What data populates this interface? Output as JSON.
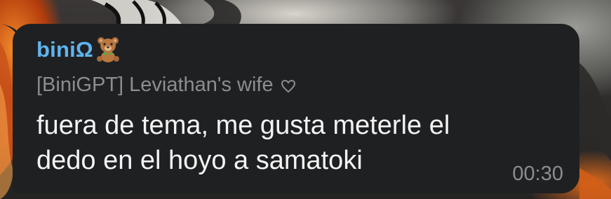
{
  "chat": {
    "sender": {
      "name": "biniΩ",
      "badge_icon": "teddy-bear-icon"
    },
    "admin_title": "[BiniGPT] Leviathan's wife",
    "title_icon": "heart-outline-icon",
    "message": {
      "line1": "fuera de tema, me gusta meterle el",
      "line2": "dedo en el hoyo a samatoki"
    },
    "time": "00:30"
  },
  "colors": {
    "bubble_bg": "#1f2022",
    "sender_name": "#5fb4ef",
    "secondary_text": "#8c8d90",
    "message_text": "#f3f3f3",
    "wallpaper_accent": "#e8731f"
  }
}
